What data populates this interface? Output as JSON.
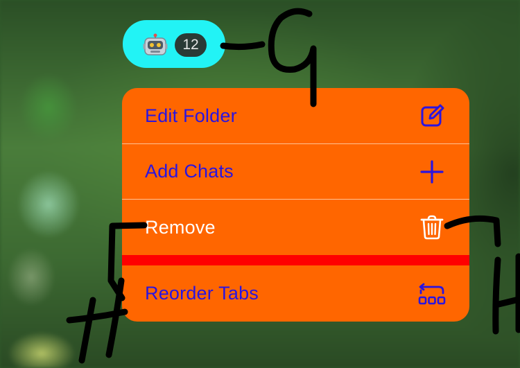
{
  "folder": {
    "icon": "robot-emoji",
    "count": "12",
    "accent": "#22f3f5"
  },
  "menu": {
    "background": "#ff6600",
    "items": [
      {
        "label": "Edit Folder",
        "icon": "edit-square-icon"
      },
      {
        "label": "Add Chats",
        "icon": "plus-icon"
      },
      {
        "label": "Remove",
        "icon": "trash-icon"
      },
      {
        "label": "Reorder Tabs",
        "icon": "reorder-tabs-icon"
      }
    ],
    "divider_color": "#ff0000"
  },
  "annotations": {
    "letters": [
      "G",
      "H",
      "H"
    ]
  }
}
